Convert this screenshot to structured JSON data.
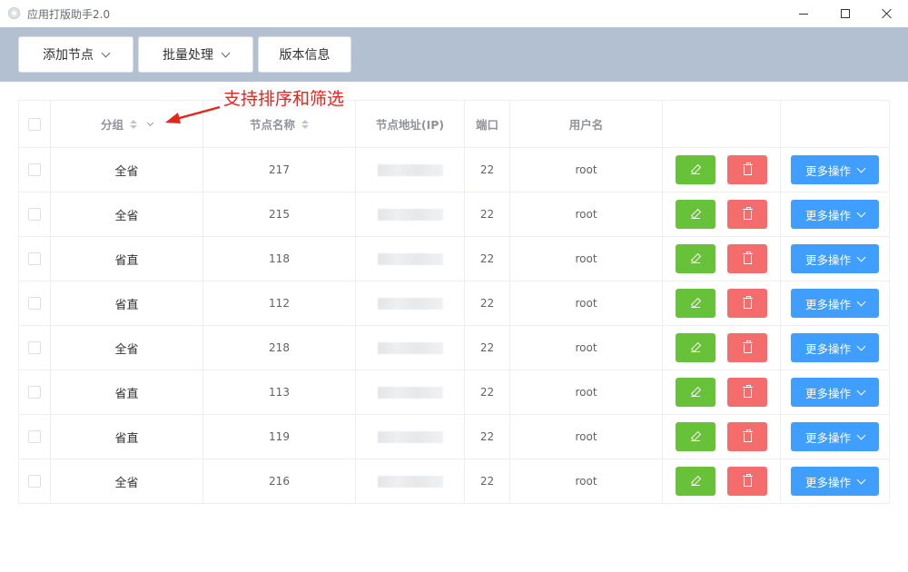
{
  "window": {
    "title": "应用打版助手2.0"
  },
  "toolbar": {
    "add_node": "添加节点",
    "batch": "批量处理",
    "version": "版本信息"
  },
  "table": {
    "columns": {
      "group": "分组",
      "name": "节点名称",
      "address": "节点地址(IP)",
      "port": "端口",
      "user": "用户名"
    },
    "more_label": "更多操作",
    "rows": [
      {
        "group": "全省",
        "name": "217",
        "port": "22",
        "user": "root"
      },
      {
        "group": "全省",
        "name": "215",
        "port": "22",
        "user": "root"
      },
      {
        "group": "省直",
        "name": "118",
        "port": "22",
        "user": "root"
      },
      {
        "group": "省直",
        "name": "112",
        "port": "22",
        "user": "root"
      },
      {
        "group": "全省",
        "name": "218",
        "port": "22",
        "user": "root"
      },
      {
        "group": "省直",
        "name": "113",
        "port": "22",
        "user": "root"
      },
      {
        "group": "省直",
        "name": "119",
        "port": "22",
        "user": "root"
      },
      {
        "group": "全省",
        "name": "216",
        "port": "22",
        "user": "root"
      }
    ]
  },
  "annotation": {
    "text": "支持排序和筛选",
    "color": "#e8231a"
  },
  "colors": {
    "toolbar_bg": "#b3c0d1",
    "edit": "#67c23a",
    "delete": "#f56c6c",
    "primary": "#409eff"
  }
}
